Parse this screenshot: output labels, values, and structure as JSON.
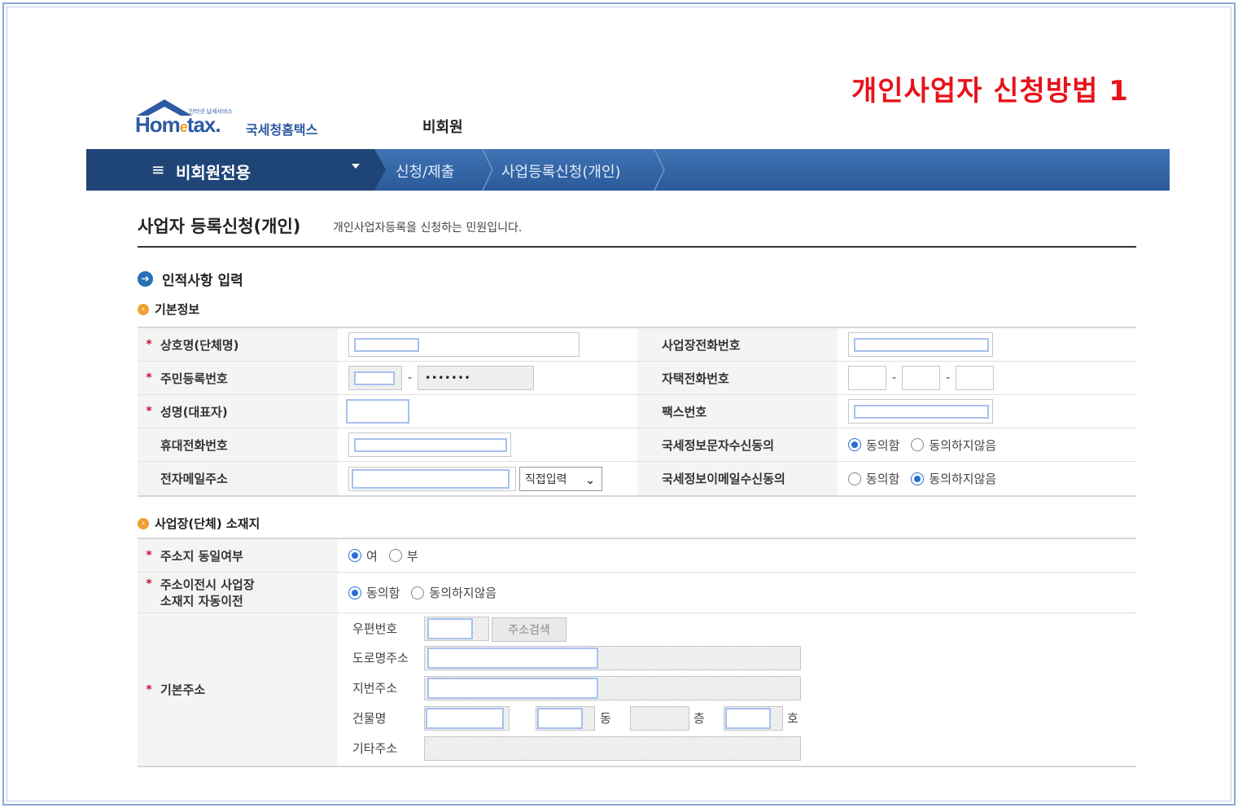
{
  "slide_title": "개인사업자 신청방법 1",
  "logo": {
    "word_a": "Hom",
    "word_e": "e",
    "word_b": "tax.",
    "tagline": "인터넷 납세서비스",
    "korean": "국세청홈택스"
  },
  "header": {
    "member_type": "비회원"
  },
  "nav": {
    "menu_icon": "≡",
    "menu_label": "비회원전용",
    "crumbs": [
      "신청/제출",
      "사업등록신청(개인)"
    ]
  },
  "page": {
    "title": "사업자 등록신청(개인)",
    "desc": "개인사업자등록을 신청하는 민원입니다."
  },
  "section": {
    "icon": "➔",
    "label": "인적사항 입력"
  },
  "basic": {
    "heading": "기본정보",
    "required_mark": "*",
    "left": [
      {
        "label": "상호명(단체명)"
      },
      {
        "label": "주민등록번호",
        "masked": "•••••••",
        "dash": "-"
      },
      {
        "label": "성명(대표자)"
      },
      {
        "label": "휴대전화번호"
      },
      {
        "label": "전자메일주소",
        "domain_select": "직접입력"
      }
    ],
    "right": [
      {
        "label": "사업장전화번호"
      },
      {
        "label": "자택전화번호",
        "dash": "-"
      },
      {
        "label": "팩스번호"
      },
      {
        "label": "국세정보문자수신동의",
        "options": [
          "동의함",
          "동의하지않음"
        ],
        "selected": "동의함"
      },
      {
        "label": "국세정보이메일수신동의",
        "options": [
          "동의함",
          "동의하지않음"
        ],
        "selected": "동의하지않음"
      }
    ]
  },
  "location": {
    "heading": "사업장(단체) 소재지",
    "same_address": {
      "label": "주소지 동일여부",
      "options": [
        "여",
        "부"
      ],
      "selected": "여"
    },
    "auto_move": {
      "label_line1": "주소이전시 사업장",
      "label_line2": "소재지 자동이전",
      "options": [
        "동의함",
        "동의하지않음"
      ],
      "selected": "동의함"
    },
    "base_address": {
      "label": "기본주소",
      "postcode_label": "우편번호",
      "search_button": "주소검색",
      "road_label": "도로명주소",
      "lot_label": "지번주소",
      "building_label": "건물명",
      "dong_unit": "동",
      "floor_unit": "층",
      "ho_unit": "호",
      "etc_label": "기타주소"
    }
  }
}
